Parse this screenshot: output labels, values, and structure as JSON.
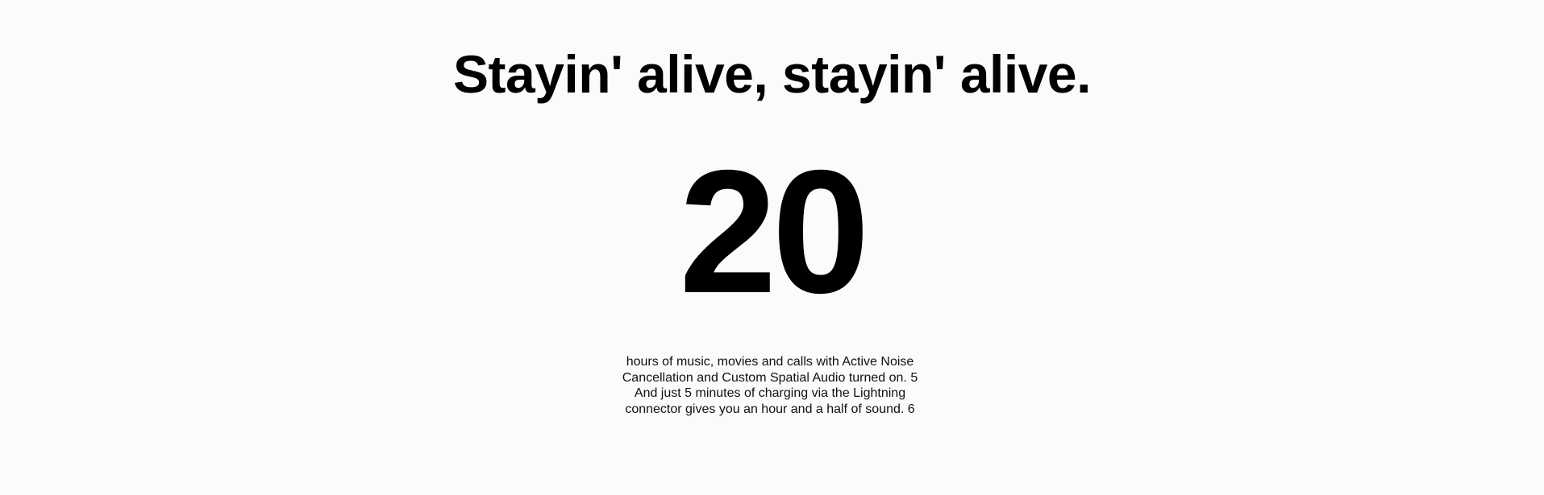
{
  "hero": {
    "headline": "Stayin' alive, stayin' alive.",
    "stat_value": "20",
    "description": {
      "text_part1": "hours of music, movies and calls with Active Noise Cancellation and Custom Spatial Audio turned on.",
      "footnote1": "5",
      "text_part2": "And just 5 minutes of charging via the Lightning connector gives you an hour and a half of sound.",
      "footnote2": "6"
    }
  }
}
